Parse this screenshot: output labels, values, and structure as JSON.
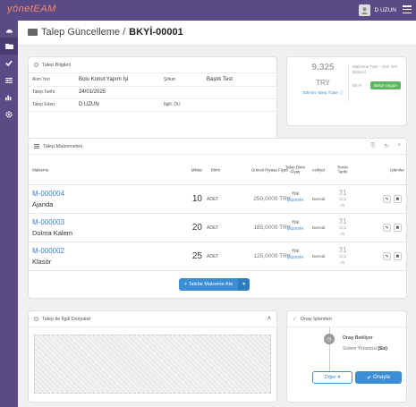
{
  "topbar": {
    "brand": "yönetEAM",
    "user_name": "D UZUN"
  },
  "page": {
    "title_prefix": "Talep Güncelleme /",
    "title_code": "BKYİ-00001"
  },
  "info": {
    "header": "Talep Bilgileri",
    "rows": [
      {
        "label1": "Alım Yeri",
        "value1": "Bolu Konut Yapım İşi",
        "label2": "Şirket",
        "value2": "Başlık Test"
      },
      {
        "label1": "Talep Tarihi",
        "value1": "24/01/2025",
        "label2": "",
        "value2": ""
      },
      {
        "label1": "Talep Eden",
        "value1": "D UZUN",
        "label2": "İlgili: DU",
        "value2": ""
      }
    ]
  },
  "stat": {
    "amount": "9.325",
    "currency": "TRY",
    "amount_label": "Tahmini Talep Tutarı ⓘ",
    "side_label": "Malzeme Türü - Alım Yeri Bütçesi",
    "side_code": "BKYİ",
    "badge": "Bütçe Uygun",
    "badge_color": "#5cb85c"
  },
  "materials": {
    "header": "Talep Malzemeleri",
    "columns": [
      "Malzeme",
      "Miktar",
      "Birim",
      "Güncel Piyasa Fiyatı",
      "Talep Birim Fiyatı",
      "Aciliyet",
      "Temin Tarihi",
      "İşlemler"
    ],
    "rows": [
      {
        "code": "M-000004",
        "name": "Ajanda",
        "qty": "10",
        "unit": "ADET",
        "price": "250,0000 TRY",
        "req_price": "Yok",
        "edit": "Düzenle",
        "priority": "Normal",
        "day": "31",
        "month": "Oca",
        "year": "25"
      },
      {
        "code": "M-000003",
        "name": "Dolma Kalem",
        "qty": "20",
        "unit": "ADET",
        "price": "185,0000 TRY",
        "req_price": "Yok",
        "edit": "Düzenle",
        "priority": "Normal",
        "day": "31",
        "month": "Oca",
        "year": "25"
      },
      {
        "code": "M-000002",
        "name": "Klasör",
        "qty": "25",
        "unit": "ADET",
        "price": "125,0000 TRY",
        "req_price": "Yok",
        "edit": "Düzenle",
        "priority": "Normal",
        "day": "31",
        "month": "Oca",
        "year": "25"
      }
    ],
    "assign_button": "+ Talebe Malzeme Ata",
    "accent": "#3a8ed6"
  },
  "files": {
    "header": "Talep ile İlgili Dosyalar"
  },
  "approval": {
    "header": "Onay İşlemleri",
    "status": "Onay Bekliyor",
    "approver": "Sistem Yöneticisi",
    "approver_suffix": "(Siz)",
    "other_button": "Diğer ▾",
    "approve_button": "Onayla"
  }
}
